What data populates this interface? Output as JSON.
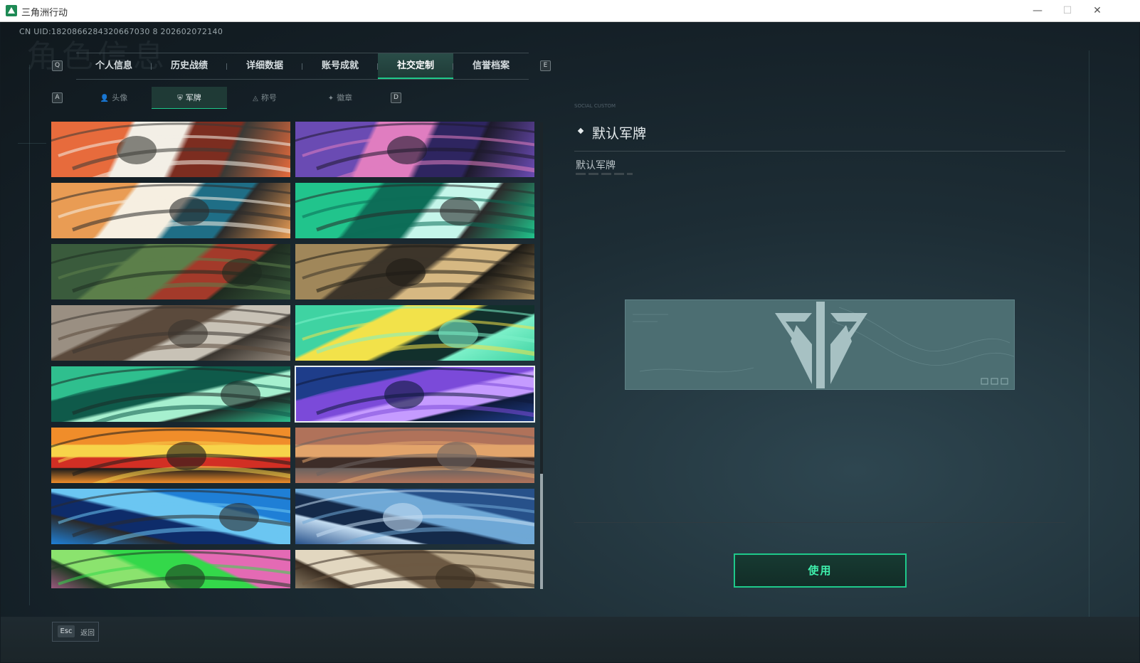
{
  "window": {
    "title": "三角洲行动",
    "min": "—",
    "max": "☐",
    "close": "✕"
  },
  "uid_text": "CN UID:1820866284320667030 8 202602072140",
  "bg_title": "角色信息",
  "nav": {
    "left_key": "Q",
    "right_key": "E",
    "tabs": [
      "个人信息",
      "历史战绩",
      "详细数据",
      "账号成就",
      "社交定制",
      "信誉档案"
    ],
    "active_tab": 4
  },
  "subnav": {
    "left_key": "A",
    "right_key": "D",
    "tabs": [
      {
        "icon": "👤",
        "label": "头像"
      },
      {
        "icon": "⛨",
        "label": "军牌"
      },
      {
        "icon": "◬",
        "label": "称号"
      },
      {
        "icon": "✦",
        "label": "徽章"
      }
    ],
    "active_tab": 1
  },
  "plates": [
    {
      "name": "plate-1",
      "colors": [
        "#e76b3c",
        "#f3efe6",
        "#7c2d20",
        "#3b3a36"
      ]
    },
    {
      "name": "plate-2",
      "colors": [
        "#6a4bb3",
        "#e07dc0",
        "#2e2560",
        "#1d1a2c"
      ]
    },
    {
      "name": "plate-3",
      "colors": [
        "#e99c54",
        "#f6efe1",
        "#1f6e86",
        "#2b2b2b"
      ]
    },
    {
      "name": "plate-4",
      "colors": [
        "#21c48c",
        "#0d6e58",
        "#c5f6ea",
        "#2a2a2a"
      ]
    },
    {
      "name": "plate-5",
      "colors": [
        "#3a5b3c",
        "#5c7f4a",
        "#a33a2a",
        "#1e2b20"
      ]
    },
    {
      "name": "plate-6",
      "colors": [
        "#a0875a",
        "#3d352a",
        "#d6b882",
        "#1e1b16"
      ]
    },
    {
      "name": "plate-7",
      "colors": [
        "#9a8f82",
        "#5b4a3c",
        "#c8c2b6",
        "#3a352f"
      ]
    },
    {
      "name": "plate-8",
      "colors": [
        "#3fd3a2",
        "#f2e24a",
        "#12302c",
        "#7bf0c8"
      ]
    },
    {
      "name": "plate-9",
      "colors": [
        "#2fbf8e",
        "#0f5a4a",
        "#a6f0cf",
        "#1c2a26"
      ]
    },
    {
      "name": "plate-10",
      "colors": [
        "#1e3d8a",
        "#7b4ad9",
        "#c59bff",
        "#0e1a3a"
      ]
    },
    {
      "name": "plate-11",
      "colors": [
        "#f08d2a",
        "#f7d34a",
        "#d22f24",
        "#1b1b1b"
      ]
    },
    {
      "name": "plate-12",
      "colors": [
        "#b0725a",
        "#e2a46b",
        "#3d2d28",
        "#6b6360"
      ]
    },
    {
      "name": "plate-13",
      "colors": [
        "#1f7fd6",
        "#6bc6f2",
        "#0e2c6a",
        "#2a2a2a"
      ]
    },
    {
      "name": "plate-14",
      "colors": [
        "#27518a",
        "#6fa8d6",
        "#142a4a",
        "#c2dbf0"
      ]
    },
    {
      "name": "plate-15",
      "colors": [
        "#e46ab4",
        "#34d84a",
        "#8be36e",
        "#1e3a22"
      ]
    },
    {
      "name": "plate-16",
      "colors": [
        "#b9a88a",
        "#6d5a44",
        "#e2d7c0",
        "#3b2e22"
      ]
    }
  ],
  "selected_plate": 9,
  "detail": {
    "small_label": "SOCIAL CUSTOM",
    "title": "默认军牌",
    "subtitle": "默认军牌"
  },
  "use_button": "使用",
  "footer": {
    "esc_key": "Esc",
    "esc_label": "返回"
  }
}
